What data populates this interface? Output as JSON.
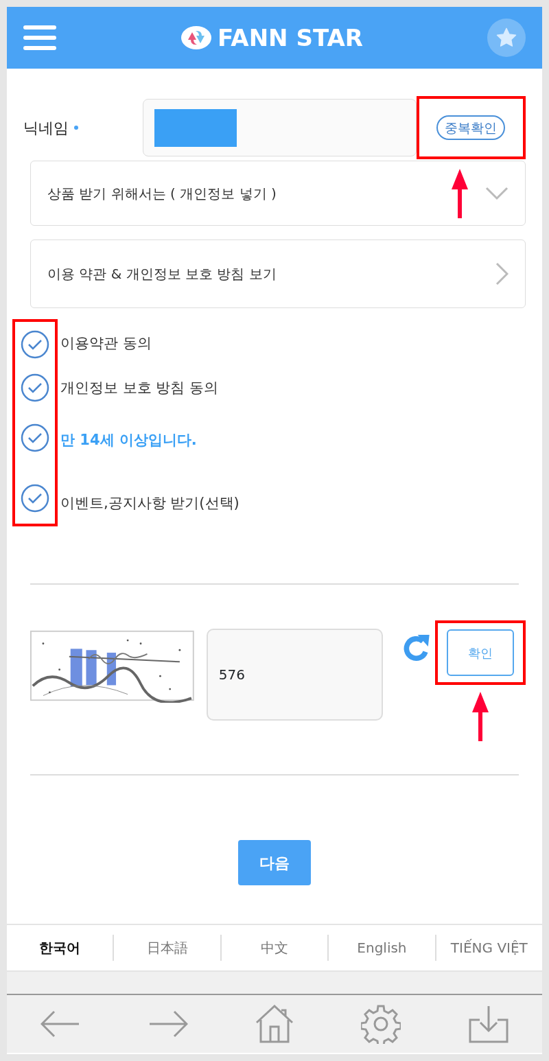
{
  "header": {
    "logo": "FANN STAR"
  },
  "nickname": {
    "label": "닉네임",
    "required": true,
    "masked": true,
    "check_button": "중복확인",
    "highlighted": true
  },
  "address_panel": {
    "label": "상품 받기 위해서는 ( 개인정보 넣기 )",
    "expanded": false
  },
  "terms_link": {
    "label": "이용 약관 & 개인정보 보호 방침 보기"
  },
  "agreements_highlighted": true,
  "agreements": [
    {
      "label": "이용약관 동의",
      "checked": true,
      "emphasis": false
    },
    {
      "label": "개인정보 보호 방침 동의",
      "checked": true,
      "emphasis": false
    },
    {
      "label": "만 14세 이상입니다.",
      "checked": true,
      "emphasis": true
    },
    {
      "label": "이벤트,공지사항 받기(선택)",
      "checked": true,
      "emphasis": false
    }
  ],
  "captcha": {
    "value": "576",
    "confirm_button": "확인",
    "highlighted": true
  },
  "next_button": "다음",
  "languages": [
    {
      "label": "한국어",
      "selected": true
    },
    {
      "label": "日本語",
      "selected": false
    },
    {
      "label": "中文",
      "selected": false
    },
    {
      "label": "English",
      "selected": false
    },
    {
      "label": "TIẾNG VIỆT",
      "selected": false
    }
  ]
}
